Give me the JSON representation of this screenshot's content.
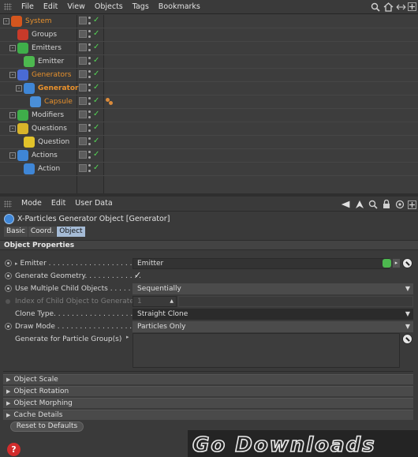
{
  "object_manager": {
    "menu": [
      "File",
      "Edit",
      "View",
      "Objects",
      "Tags",
      "Bookmarks"
    ],
    "toolbar_icons": [
      "search-icon",
      "home-icon",
      "arrows-icon",
      "new-window-icon"
    ],
    "tree": [
      {
        "name": "System",
        "level": 0,
        "expand": "-",
        "icon": "system-icon",
        "color": "#e8912c",
        "icon_color": "#d4561e",
        "highlight": true
      },
      {
        "name": "Groups",
        "level": 1,
        "expand": "",
        "icon": "groups-icon",
        "color": "#d6d6d6",
        "icon_color": "#c73a2a"
      },
      {
        "name": "Emitters",
        "level": 1,
        "expand": "-",
        "icon": "emitters-icon",
        "color": "#d6d6d6",
        "icon_color": "#3fae4a"
      },
      {
        "name": "Emitter",
        "level": 2,
        "expand": "",
        "icon": "emitter-icon",
        "color": "#d6d6d6",
        "icon_color": "#4db84f"
      },
      {
        "name": "Generators",
        "level": 1,
        "expand": "-",
        "icon": "generators-icon",
        "color": "#e8912c",
        "icon_color": "#4a6bd4",
        "highlight": true
      },
      {
        "name": "Generator",
        "level": 2,
        "expand": "-",
        "icon": "generator-icon",
        "color": "#e8912c",
        "icon_color": "#3f86d6",
        "highlight": true,
        "bold": true
      },
      {
        "name": "Capsule",
        "level": 3,
        "expand": "",
        "icon": "capsule-icon",
        "color": "#e8912c",
        "icon_color": "#4a8fd8",
        "highlight": true,
        "tag": true
      },
      {
        "name": "Modifiers",
        "level": 1,
        "expand": "-",
        "icon": "modifiers-icon",
        "color": "#d6d6d6",
        "icon_color": "#3fae4a"
      },
      {
        "name": "Questions",
        "level": 1,
        "expand": "-",
        "icon": "questions-icon",
        "color": "#d6d6d6",
        "icon_color": "#d8b42a"
      },
      {
        "name": "Question",
        "level": 2,
        "expand": "",
        "icon": "question-icon",
        "color": "#d6d6d6",
        "icon_color": "#e2c32a"
      },
      {
        "name": "Actions",
        "level": 1,
        "expand": "-",
        "icon": "actions-icon",
        "color": "#d6d6d6",
        "icon_color": "#3f86d6"
      },
      {
        "name": "Action",
        "level": 2,
        "expand": "",
        "icon": "action-icon",
        "color": "#d6d6d6",
        "icon_color": "#3f86d6"
      }
    ]
  },
  "attribute_manager": {
    "menu": [
      "Mode",
      "Edit",
      "User Data"
    ],
    "title": "X-Particles Generator Object [Generator]",
    "tabs": [
      {
        "label": "Basic",
        "active": false
      },
      {
        "label": "Coord.",
        "active": false
      },
      {
        "label": "Object",
        "active": true
      }
    ],
    "section_title": "Object Properties",
    "properties": {
      "emitter": {
        "label": "Emitter . . . . . . . . . . . . . . . . . . .",
        "value": "Emitter"
      },
      "generate_geometry": {
        "label": "Generate Geometry. . . . . . . . . . . . .",
        "checked": true,
        "check_glyph": "✓"
      },
      "use_multiple": {
        "label": "Use Multiple Child Objects . . . . . .",
        "value": "Sequentially"
      },
      "index_child": {
        "label": "Index of Child Object to Generate",
        "value": "1"
      },
      "clone_type": {
        "label": "Clone Type. . . . . . . . . . . . . . . . . .",
        "value": "Straight Clone"
      },
      "draw_mode": {
        "label": "Draw Mode . . . . . . . . . . . . . . . . .",
        "value": "Particles Only"
      },
      "generate_group": {
        "label": "Generate for Particle Group(s)"
      }
    },
    "collapsed_sections": [
      "Object Scale",
      "Object Rotation",
      "Object Morphing",
      "Cache Details"
    ],
    "reset_button": "Reset to Defaults"
  },
  "watermark": "Go Downloads",
  "help_icon": "?"
}
